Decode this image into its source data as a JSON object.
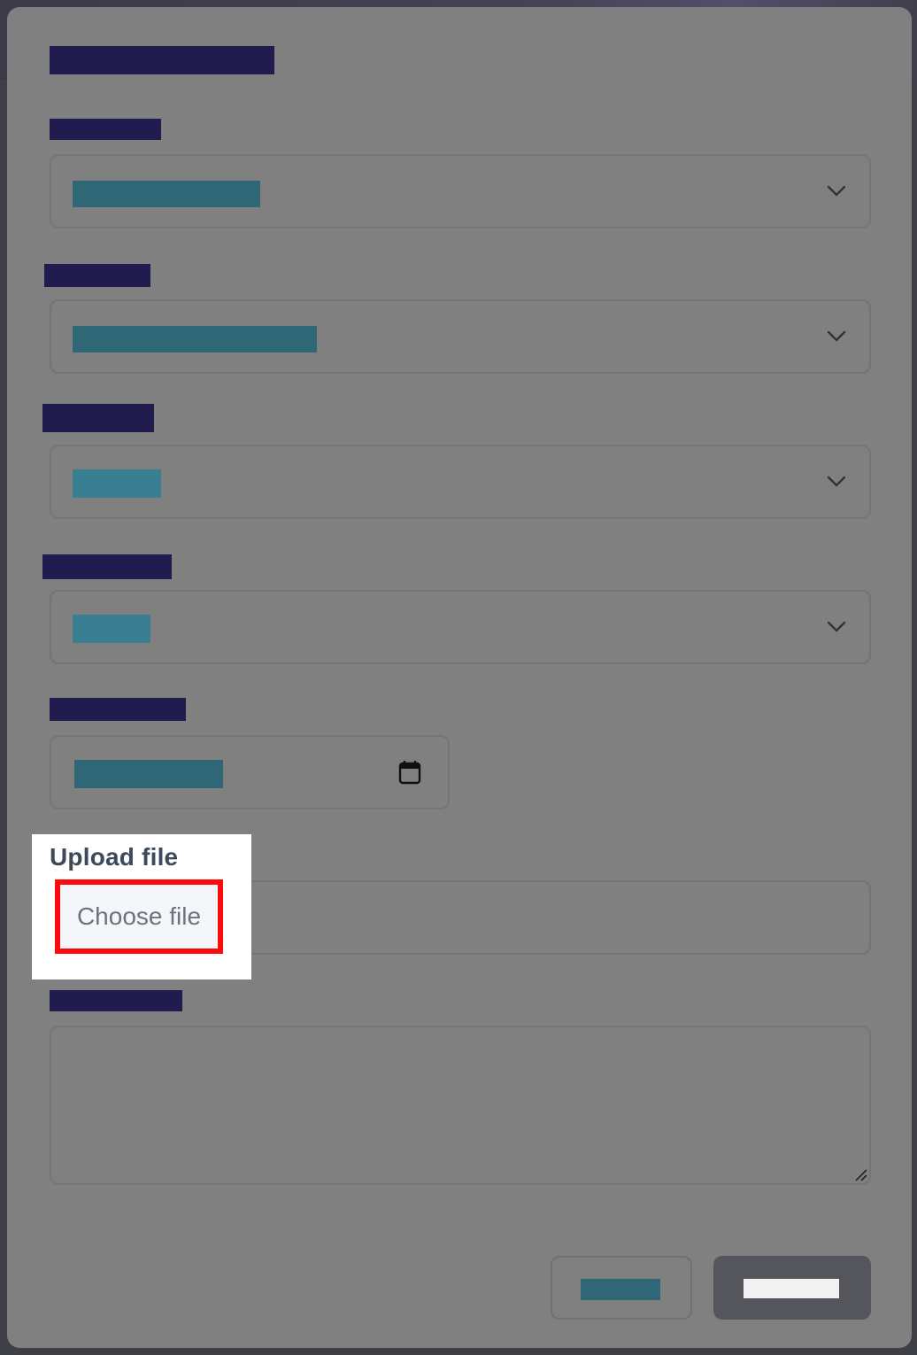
{
  "upload": {
    "label": "Upload file",
    "button_label": "Choose file"
  },
  "icons": {
    "select_chevron": "chevron-down-icon",
    "date_picker": "calendar-icon",
    "textarea_resize": "resize-handle-icon"
  },
  "colors": {
    "modal_bg": "#808080",
    "redaction_label": "#201d4e",
    "redaction_value": "#2f6776",
    "highlight_border": "#ff0a0a",
    "primary_button": "#55565c"
  }
}
